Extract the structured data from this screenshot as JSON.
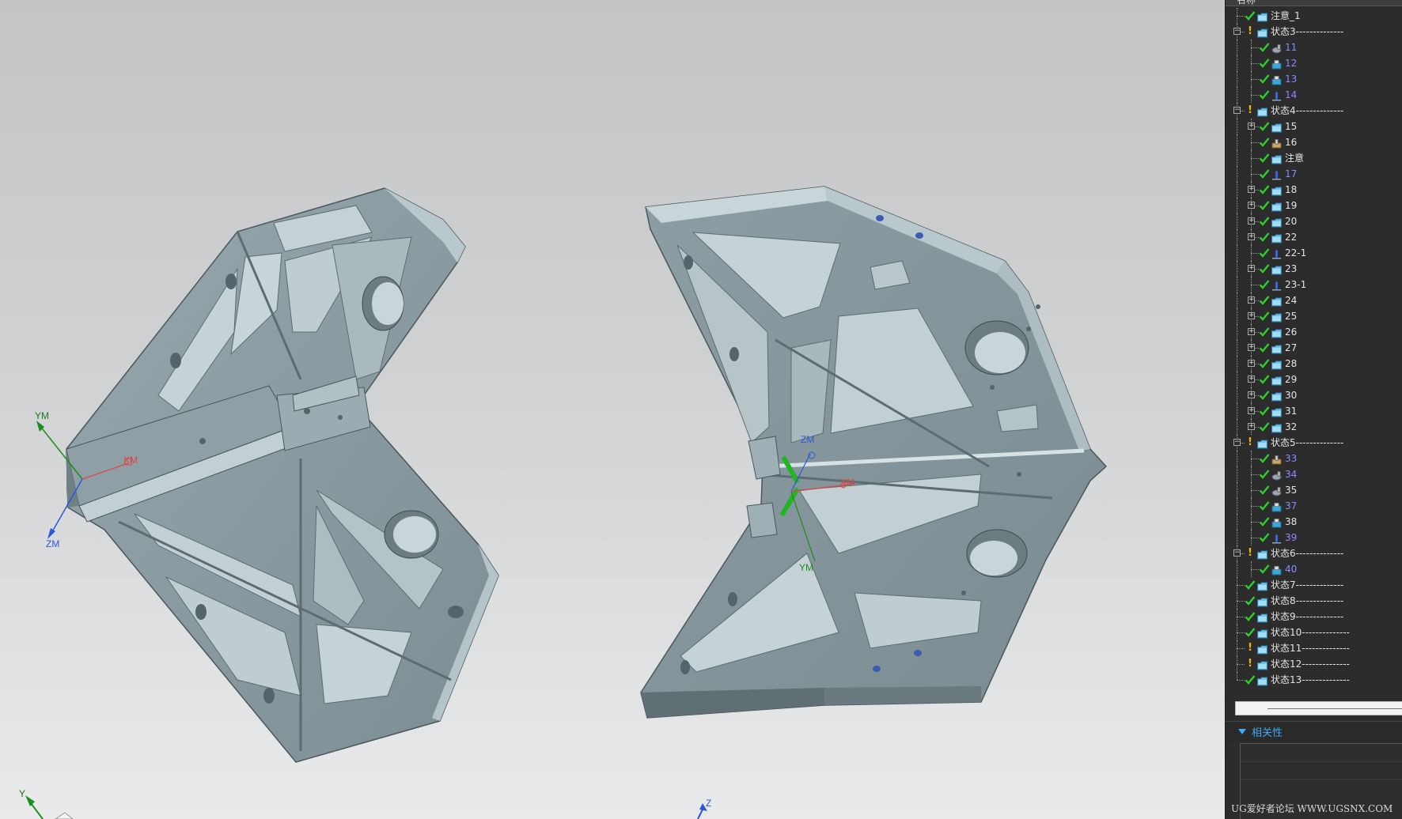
{
  "viewport": {
    "left_part": {
      "axis_labels": {
        "ym": "YM",
        "xm": "XM",
        "zm": "ZM"
      }
    },
    "right_part": {
      "axis_labels": {
        "zm": "ZM",
        "xm": "XM",
        "ym": "YM"
      }
    },
    "triad": {
      "y": "Y",
      "z": "Z"
    }
  },
  "navigator": {
    "column_header": "名称",
    "items": [
      {
        "label": "注意_1",
        "level": 1,
        "status": "check",
        "icon": "folder-icon"
      },
      {
        "label": "状态3--------------",
        "level": 1,
        "status": "warn",
        "expander": "-",
        "icon": "folder-icon"
      },
      {
        "label": "11",
        "level": 2,
        "status": "check",
        "icon": "gear-op-icon",
        "link": true
      },
      {
        "label": "12",
        "level": 2,
        "status": "check",
        "icon": "machine-op-icon",
        "link": true
      },
      {
        "label": "13",
        "level": 2,
        "status": "check",
        "icon": "machine-op-icon",
        "link": true
      },
      {
        "label": "14",
        "level": 2,
        "status": "check",
        "icon": "drill-op-icon",
        "link": true
      },
      {
        "label": "状态4--------------",
        "level": 1,
        "status": "warn",
        "expander": "-",
        "icon": "folder-icon"
      },
      {
        "label": "15",
        "level": 2,
        "status": "check",
        "expander": "+",
        "icon": "folder-icon"
      },
      {
        "label": "16",
        "level": 2,
        "status": "check",
        "icon": "tool-op-icon"
      },
      {
        "label": "注意",
        "level": 2,
        "status": "check",
        "icon": "folder-icon"
      },
      {
        "label": "17",
        "level": 2,
        "status": "check",
        "icon": "drill-op-icon",
        "link": true
      },
      {
        "label": "18",
        "level": 2,
        "status": "check",
        "expander": "+",
        "icon": "folder-icon"
      },
      {
        "label": "19",
        "level": 2,
        "status": "check",
        "expander": "+",
        "icon": "folder-icon"
      },
      {
        "label": "20",
        "level": 2,
        "status": "check",
        "expander": "+",
        "icon": "folder-icon"
      },
      {
        "label": "22",
        "level": 2,
        "status": "check",
        "expander": "+",
        "icon": "folder-icon"
      },
      {
        "label": "22-1",
        "level": 2,
        "status": "check",
        "icon": "drill-op-icon"
      },
      {
        "label": "23",
        "level": 2,
        "status": "check",
        "expander": "+",
        "icon": "folder-icon"
      },
      {
        "label": "23-1",
        "level": 2,
        "status": "check",
        "icon": "drill-op-icon"
      },
      {
        "label": "24",
        "level": 2,
        "status": "check",
        "expander": "+",
        "icon": "folder-icon"
      },
      {
        "label": "25",
        "level": 2,
        "status": "check",
        "expander": "+",
        "icon": "folder-icon"
      },
      {
        "label": "26",
        "level": 2,
        "status": "check",
        "expander": "+",
        "icon": "folder-icon"
      },
      {
        "label": "27",
        "level": 2,
        "status": "check",
        "expander": "+",
        "icon": "folder-icon"
      },
      {
        "label": "28",
        "level": 2,
        "status": "check",
        "expander": "+",
        "icon": "folder-icon"
      },
      {
        "label": "29",
        "level": 2,
        "status": "check",
        "expander": "+",
        "icon": "folder-icon"
      },
      {
        "label": "30",
        "level": 2,
        "status": "check",
        "expander": "+",
        "icon": "folder-icon"
      },
      {
        "label": "31",
        "level": 2,
        "status": "check",
        "expander": "+",
        "icon": "folder-icon"
      },
      {
        "label": "32",
        "level": 2,
        "status": "check",
        "expander": "+",
        "icon": "folder-icon"
      },
      {
        "label": "状态5--------------",
        "level": 1,
        "status": "warn",
        "expander": "-",
        "icon": "folder-icon"
      },
      {
        "label": "33",
        "level": 2,
        "status": "check",
        "icon": "tool-op-icon",
        "link": true
      },
      {
        "label": "34",
        "level": 2,
        "status": "check",
        "icon": "gear-op-icon",
        "link": true
      },
      {
        "label": "35",
        "level": 2,
        "status": "check",
        "icon": "gear-op-icon"
      },
      {
        "label": "37",
        "level": 2,
        "status": "check",
        "icon": "machine-op-icon",
        "link": true
      },
      {
        "label": "38",
        "level": 2,
        "status": "check",
        "icon": "machine-op-icon"
      },
      {
        "label": "39",
        "level": 2,
        "status": "check",
        "icon": "drill-op-icon",
        "link": true
      },
      {
        "label": "状态6--------------",
        "level": 1,
        "status": "warn",
        "expander": "-",
        "icon": "folder-icon"
      },
      {
        "label": "40",
        "level": 2,
        "status": "check",
        "icon": "machine-op-icon",
        "link": true
      },
      {
        "label": "状态7--------------",
        "level": 1,
        "status": "check",
        "icon": "folder-icon"
      },
      {
        "label": "状态8--------------",
        "level": 1,
        "status": "check",
        "icon": "folder-icon"
      },
      {
        "label": "状态9--------------",
        "level": 1,
        "status": "check",
        "icon": "folder-icon"
      },
      {
        "label": "状态10--------------",
        "level": 1,
        "status": "check",
        "icon": "folder-icon"
      },
      {
        "label": "状态11--------------",
        "level": 1,
        "status": "warn",
        "icon": "folder-icon"
      },
      {
        "label": "状态12--------------",
        "level": 1,
        "status": "warn",
        "icon": "folder-icon"
      },
      {
        "label": "状态13--------------",
        "level": 1,
        "status": "check",
        "icon": "folder-icon"
      }
    ]
  },
  "relations_panel": {
    "title": "相关性"
  },
  "watermark": "UG爱好者论坛 WWW.UGSNX.COM",
  "colors": {
    "check": "#2ed12e",
    "warn": "#f0b400",
    "link_text": "#8a8aff",
    "part_face": "#8fa2a8",
    "part_light": "#b7c6ca",
    "part_dark": "#5d6c71",
    "panel_bg": "#2c2c2c",
    "accent": "#3fa9f5"
  }
}
